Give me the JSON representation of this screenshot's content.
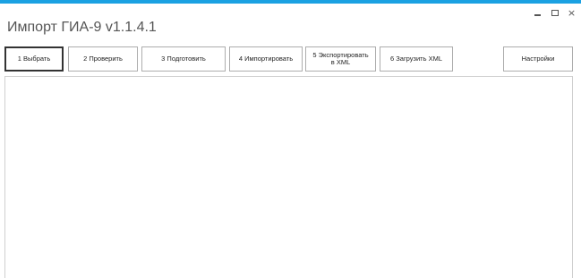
{
  "window": {
    "title": "Импорт ГИА-9 v1.1.4.1",
    "controls": {
      "close": "×"
    }
  },
  "toolbar": {
    "buttons": [
      {
        "label": "1   Выбрать"
      },
      {
        "label": "2   Проверить"
      },
      {
        "label": "3  Подготовить"
      },
      {
        "label": "4 Импортировать"
      },
      {
        "label": "5 Экспортировать\nв XML"
      },
      {
        "label": "6 Загрузить XML"
      }
    ],
    "settings_label": "Настройки"
  },
  "content": {
    "lines": []
  }
}
